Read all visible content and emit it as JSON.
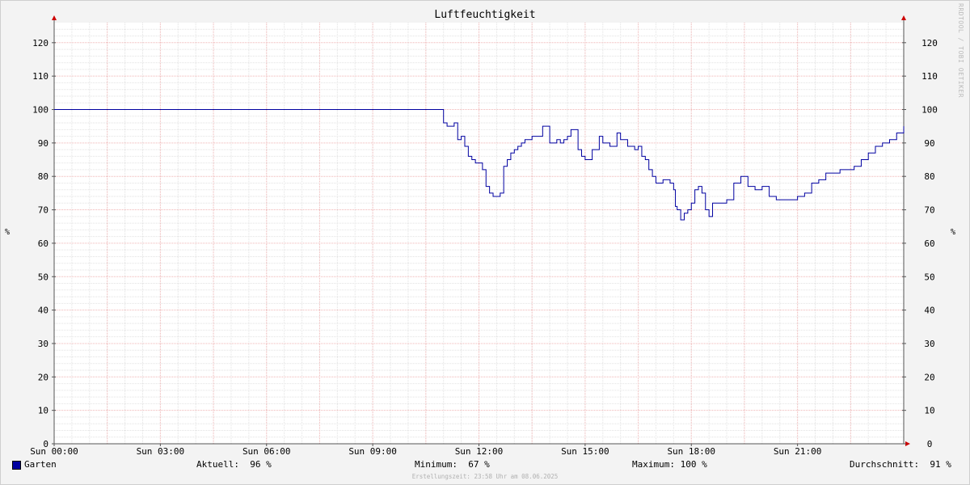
{
  "title": "Luftfeuchtigkeit",
  "watermark": "RRDTOOL / TOBI OETIKER",
  "footer": "Erstellungszeit: 23:58 Uhr am 08.06.2025",
  "colors": {
    "line": "#0000a0",
    "grid_minor": "#e2e2e2",
    "grid_major": "#f0b4b4",
    "axis": "#cc0000",
    "plot_bg": "#ffffff"
  },
  "legend": {
    "series_name": "Garten",
    "current": "Aktuell:  96 %",
    "minimum": "Minimum:  67 %",
    "maximum": "Maximum: 100 %",
    "average": "Durchschnitt:  91 %"
  },
  "chart_data": {
    "type": "line",
    "title": "Luftfeuchtigkeit",
    "ylabel": "%",
    "ylim": [
      0,
      126
    ],
    "xlim": [
      0,
      24
    ],
    "y_ticks": [
      0,
      10,
      20,
      30,
      40,
      50,
      60,
      70,
      80,
      90,
      100,
      110,
      120
    ],
    "x_ticks": [
      {
        "x": 0,
        "label": "Sun 00:00"
      },
      {
        "x": 3,
        "label": "Sun 03:00"
      },
      {
        "x": 6,
        "label": "Sun 06:00"
      },
      {
        "x": 9,
        "label": "Sun 09:00"
      },
      {
        "x": 12,
        "label": "Sun 12:00"
      },
      {
        "x": 15,
        "label": "Sun 15:00"
      },
      {
        "x": 18,
        "label": "Sun 18:00"
      },
      {
        "x": 21,
        "label": "Sun 21:00"
      }
    ],
    "grid": true,
    "legend_position": "bottom",
    "series": [
      {
        "name": "Garten",
        "x": [
          0,
          10.9,
          11.0,
          11.1,
          11.3,
          11.4,
          11.5,
          11.6,
          11.7,
          11.8,
          11.9,
          12.0,
          12.1,
          12.2,
          12.3,
          12.4,
          12.5,
          12.6,
          12.7,
          12.8,
          12.9,
          13.0,
          13.1,
          13.2,
          13.3,
          13.4,
          13.5,
          13.6,
          13.8,
          14.0,
          14.2,
          14.3,
          14.4,
          14.5,
          14.6,
          14.8,
          14.9,
          15.0,
          15.2,
          15.4,
          15.5,
          15.7,
          15.9,
          16.0,
          16.2,
          16.4,
          16.5,
          16.6,
          16.7,
          16.8,
          16.9,
          17.0,
          17.2,
          17.4,
          17.5,
          17.55,
          17.6,
          17.7,
          17.8,
          17.9,
          18.0,
          18.1,
          18.2,
          18.3,
          18.4,
          18.5,
          18.6,
          18.8,
          19.0,
          19.2,
          19.4,
          19.6,
          19.8,
          20.0,
          20.2,
          20.4,
          20.6,
          20.8,
          21.0,
          21.2,
          21.4,
          21.6,
          21.8,
          22.0,
          22.2,
          22.4,
          22.6,
          22.8,
          23.0,
          23.2,
          23.4,
          23.6,
          23.8,
          24.0
        ],
        "values": [
          100,
          100,
          96,
          95,
          96,
          91,
          92,
          89,
          86,
          85,
          84,
          84,
          82,
          77,
          75,
          74,
          74,
          75,
          83,
          85,
          87,
          88,
          89,
          90,
          91,
          91,
          92,
          92,
          95,
          90,
          91,
          90,
          91,
          92,
          94,
          88,
          86,
          85,
          88,
          92,
          90,
          89,
          93,
          91,
          89,
          88,
          89,
          86,
          85,
          82,
          80,
          78,
          79,
          78,
          76,
          71,
          70,
          67,
          69,
          70,
          72,
          76,
          77,
          75,
          70,
          68,
          72,
          72,
          73,
          78,
          80,
          77,
          76,
          77,
          74,
          73,
          73,
          73,
          74,
          75,
          78,
          79,
          81,
          81,
          82,
          82,
          83,
          85,
          87,
          89,
          90,
          91,
          93,
          95
        ]
      }
    ]
  }
}
